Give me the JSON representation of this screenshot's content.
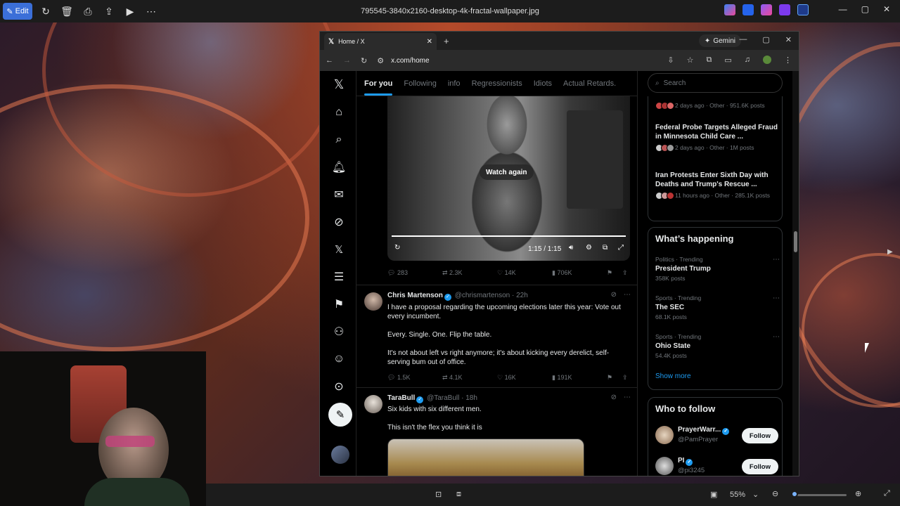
{
  "viewer": {
    "edit_label": "Edit",
    "file_name": "795545-3840x2160-desktop-4k-fractal-wallpaper.jpg",
    "zoom": "55%"
  },
  "browser": {
    "tab_title": "Home / X",
    "gemini_label": "Gemini",
    "url": "x.com/home"
  },
  "x": {
    "tabs": [
      "For you",
      "Following",
      "info",
      "Regressionists",
      "Idiots",
      "Actual Retards."
    ],
    "video": {
      "watch_again": "Watch again",
      "time": "1:15 / 1:15"
    },
    "video_actions": {
      "replies": "283",
      "reposts": "2.3K",
      "likes": "14K",
      "views": "706K"
    },
    "tweets": [
      {
        "name": "Chris Martenson",
        "handle": "@chrismartenson",
        "time": "22h",
        "lines": [
          "I have a proposal regarding the upcoming elections later this year:  Vote out every incumbent.",
          "Every. Single. One.  Flip the table.",
          "It's not about left vs right anymore; it's about kicking every derelict, self-serving bum out of office."
        ],
        "actions": {
          "replies": "1.5K",
          "reposts": "4.1K",
          "likes": "16K",
          "views": "191K"
        }
      },
      {
        "name": "TaraBull",
        "handle": "@TaraBull",
        "time": "18h",
        "lines": [
          "Six kids with six different men.",
          "This isn't the flex you think it is"
        ]
      }
    ],
    "search_placeholder": "Search",
    "news": [
      {
        "title": "",
        "meta": "2 days ago · Other · 951.6K posts"
      },
      {
        "title": "Federal Probe Targets Alleged Fraud in Minnesota Child Care ...",
        "meta": "2 days ago · Other · 1M posts"
      },
      {
        "title": "Iran Protests Enter Sixth Day with Deaths and Trump's Rescue ...",
        "meta": "11 hours ago · Other · 285.1K posts"
      }
    ],
    "whats_happening": {
      "title": "What’s happening",
      "trends": [
        {
          "category": "Politics · Trending",
          "name": "President Trump",
          "count": "358K posts"
        },
        {
          "category": "Sports · Trending",
          "name": "The SEC",
          "count": "68.1K posts"
        },
        {
          "category": "Sports · Trending",
          "name": "Ohio State",
          "count": "54.4K posts"
        }
      ],
      "show_more": "Show more"
    },
    "who_to_follow": {
      "title": "Who to follow",
      "accounts": [
        {
          "name": "PrayerWarr...",
          "handle": "@PamPrayer",
          "button": "Follow"
        },
        {
          "name": "PI",
          "handle": "@pi3245",
          "button": "Follow"
        }
      ]
    }
  }
}
